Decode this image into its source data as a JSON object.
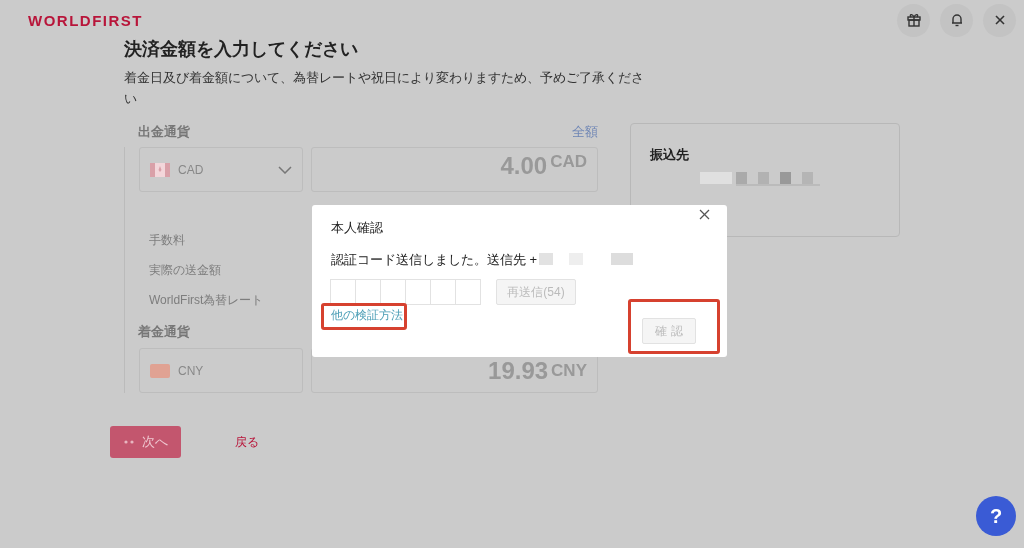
{
  "header": {
    "logo": "WORLDFIRST"
  },
  "page": {
    "title": "決済金額を入力してください",
    "subtitle": "着金日及び着金額について、為替レートや祝日により変わりますため、予めご了承ください"
  },
  "send": {
    "label": "出金通貨",
    "all_link": "全額",
    "currency": "CAD",
    "amount": "4.00",
    "amount_currency": "CAD"
  },
  "fees": [
    {
      "label": "手数料"
    },
    {
      "label": "実際の送金額"
    },
    {
      "label": "WorldFirst為替レート"
    }
  ],
  "receive": {
    "label": "着金通貨",
    "currency": "CNY",
    "amount": "19.93",
    "amount_currency": "CNY"
  },
  "actions": {
    "next": {
      "label": "次へ",
      "loading": true
    },
    "back": "戻る"
  },
  "payee_card": {
    "title": "振込先"
  },
  "dialog": {
    "title": "本人確認",
    "message": "認証コード送信しました。送信先 +",
    "code_fields": [
      {
        "filled": false
      },
      {
        "filled": false
      },
      {
        "filled": false
      },
      {
        "filled": false
      },
      {
        "filled": false
      },
      {
        "filled": false
      }
    ],
    "resend": {
      "label": "再送信(54)",
      "disabled": true
    },
    "other_methods_link": {
      "label": "他の検証方法",
      "highlighted": true
    },
    "confirm": {
      "label": "確 認",
      "disabled": true,
      "highlighted": true
    }
  },
  "help_button": "?"
}
